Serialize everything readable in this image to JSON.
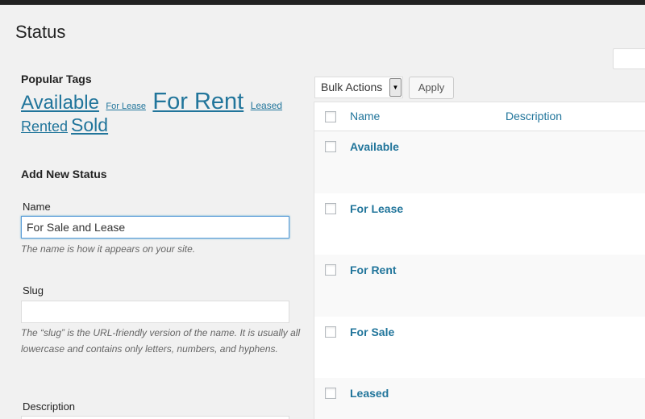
{
  "page": {
    "title": "Status"
  },
  "popular_tags": {
    "heading": "Popular Tags",
    "tags": [
      "Available",
      "For Lease",
      "For Rent",
      "Leased",
      "Rented",
      "Sold"
    ]
  },
  "add_new": {
    "heading": "Add New Status",
    "name_label": "Name",
    "name_value": "For Sale and Lease",
    "name_help": "The name is how it appears on your site.",
    "slug_label": "Slug",
    "slug_value": "",
    "slug_help": "The “slug” is the URL-friendly version of the name. It is usually all lowercase and contains only letters, numbers, and hyphens.",
    "description_label": "Description"
  },
  "toolbar": {
    "bulk_actions": "Bulk Actions",
    "apply_label": "Apply"
  },
  "table": {
    "columns": [
      "Name",
      "Description"
    ],
    "rows": [
      {
        "name": "Available"
      },
      {
        "name": "For Lease"
      },
      {
        "name": "For Rent"
      },
      {
        "name": "For Sale"
      },
      {
        "name": "Leased"
      }
    ]
  },
  "colors": {
    "link": "#21759b",
    "background": "#f1f1f1",
    "adminbar": "#222222",
    "focus": "#5b9dd9"
  }
}
